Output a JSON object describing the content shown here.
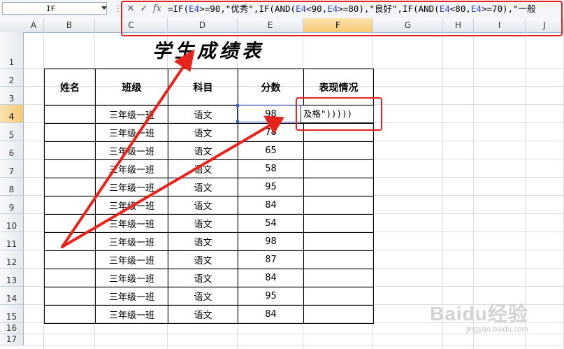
{
  "formula_bar": {
    "name_box": "IF",
    "buttons": {
      "cancel": "✕",
      "enter": "✓",
      "function": "fx"
    },
    "formula_parts": [
      {
        "t": "=IF(",
        "ref": false
      },
      {
        "t": "E4",
        "ref": true
      },
      {
        "t": ">=90,\"优秀\",IF(AND(",
        "ref": false
      },
      {
        "t": "E4",
        "ref": true
      },
      {
        "t": "<90,",
        "ref": false
      },
      {
        "t": "E4",
        "ref": true
      },
      {
        "t": ">=80),\"良好\",IF(AND(",
        "ref": false
      },
      {
        "t": "E4",
        "ref": true
      },
      {
        "t": "<80,",
        "ref": false
      },
      {
        "t": "E4",
        "ref": true
      },
      {
        "t": ">=70),\"一般",
        "ref": false
      }
    ]
  },
  "columns": [
    "A",
    "B",
    "C",
    "D",
    "E",
    "F",
    "G",
    "H",
    "I",
    "J"
  ],
  "selected_column": "F",
  "rows": [
    "1",
    "2",
    "3",
    "4",
    "5",
    "6",
    "7",
    "8",
    "9",
    "10",
    "11",
    "12",
    "13",
    "14",
    "15",
    "16",
    "17"
  ],
  "selected_row": "4",
  "sheet": {
    "title": "学生成绩表",
    "headers": [
      "姓名",
      "班级",
      "科目",
      "分数",
      "表现情况"
    ],
    "records": [
      {
        "name": "",
        "class": "三年级一班",
        "subject": "语文",
        "score": "98"
      },
      {
        "name": "",
        "class": "三年级一班",
        "subject": "语文",
        "score": "78"
      },
      {
        "name": "",
        "class": "三年级一班",
        "subject": "语文",
        "score": "65"
      },
      {
        "name": "",
        "class": "三年级一班",
        "subject": "语文",
        "score": "58"
      },
      {
        "name": "",
        "class": "三年级一班",
        "subject": "语文",
        "score": "95"
      },
      {
        "name": "",
        "class": "三年级一班",
        "subject": "语文",
        "score": "84"
      },
      {
        "name": "",
        "class": "三年级一班",
        "subject": "语文",
        "score": "54"
      },
      {
        "name": "",
        "class": "三年级一班",
        "subject": "语文",
        "score": "98"
      },
      {
        "name": "",
        "class": "三年级一班",
        "subject": "语文",
        "score": "87"
      },
      {
        "name": "",
        "class": "三年级一班",
        "subject": "语文",
        "score": "84"
      },
      {
        "name": "",
        "class": "三年级一班",
        "subject": "语文",
        "score": "95"
      },
      {
        "name": "",
        "class": "三年级一班",
        "subject": "语文",
        "score": "84"
      }
    ],
    "editing_cell_text": "及格\")))))"
  },
  "annotation_color": "#e8231c",
  "watermark": {
    "line1": "Baidu经验",
    "line2": "jingyan.baidu.com"
  }
}
